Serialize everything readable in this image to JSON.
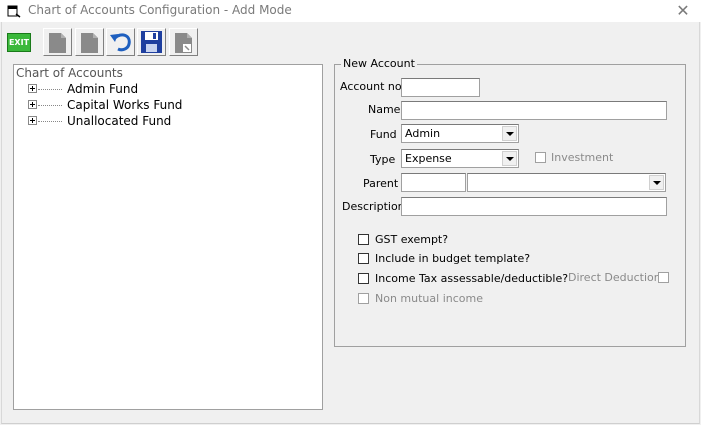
{
  "window": {
    "title": "Chart of Accounts Configuration - Add Mode",
    "close_icon": "close-icon"
  },
  "toolbar": {
    "exit_label": "EXIT",
    "buttons": [
      "new-icon",
      "copy-icon",
      "undo-icon",
      "save-icon",
      "delete-icon"
    ]
  },
  "tree": {
    "root": "Chart of Accounts",
    "items": [
      {
        "label": "Admin Fund"
      },
      {
        "label": "Capital Works Fund"
      },
      {
        "label": "Unallocated Fund"
      }
    ]
  },
  "form": {
    "group_title": "New Account",
    "account_no_label": "Account no.",
    "account_no_value": "",
    "name_label": "Name",
    "name_value": "",
    "fund_label": "Fund",
    "fund_value": "Admin",
    "type_label": "Type",
    "type_value": "Expense",
    "investment_label": "Investment",
    "parent_label": "Parent",
    "parent_code_value": "",
    "parent_name_value": "",
    "description_label": "Description",
    "description_value": "",
    "gst_label": "GST exempt?",
    "budget_label": "Include in budget template?",
    "income_tax_label": "Income Tax assessable/deductible?",
    "direct_deduction_label": "Direct Deduction",
    "non_mutual_label": "Non mutual income"
  }
}
